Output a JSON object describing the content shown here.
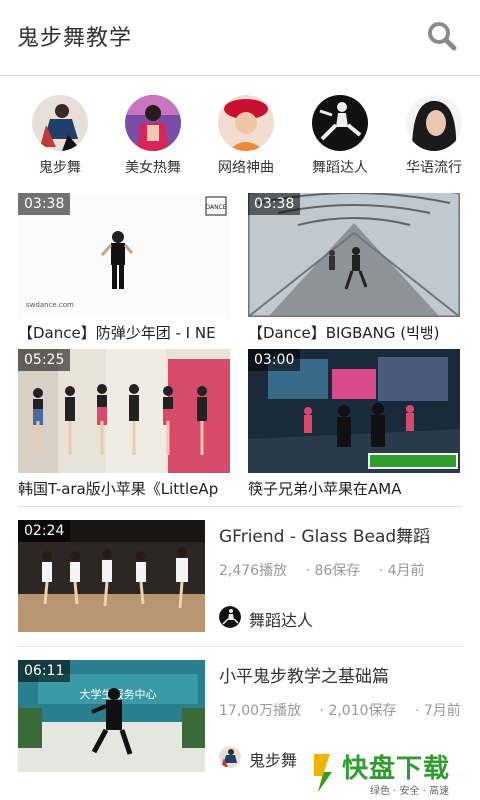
{
  "header": {
    "title": "鬼步舞教学",
    "search_icon": "search-icon"
  },
  "categories": [
    {
      "label": "鬼步舞"
    },
    {
      "label": "美女热舞"
    },
    {
      "label": "网络神曲"
    },
    {
      "label": "舞蹈达人"
    },
    {
      "label": "华语流行"
    }
  ],
  "grid": [
    {
      "duration": "03:38",
      "title": "【Dance】防弹少年团 - I NE"
    },
    {
      "duration": "03:38",
      "title": "【Dance】BIGBANG (빅뱅)"
    },
    {
      "duration": "05:25",
      "title": "韩国T-ara版小苹果《LittleAp"
    },
    {
      "duration": "03:00",
      "title": "筷子兄弟小苹果在AMA"
    }
  ],
  "rows": [
    {
      "duration": "02:24",
      "title": "GFriend - Glass Bead舞蹈",
      "plays": "2,476播放",
      "saves": "· 86保存",
      "date": "· 4月前",
      "channel": "舞蹈达人"
    },
    {
      "duration": "06:11",
      "title": "小平鬼步教学之基础篇",
      "plays": "17,00万播放",
      "saves": "· 2,010保存",
      "date": "· 7月前",
      "channel": "鬼步舞"
    }
  ],
  "watermark": {
    "main": "快盘下载",
    "sub": "绿色 · 安全 · 高速"
  },
  "colors": {
    "accent_green": "#2f9e2f",
    "watermark_yellow": "#f0b400",
    "divider": "#e2e2e2"
  }
}
